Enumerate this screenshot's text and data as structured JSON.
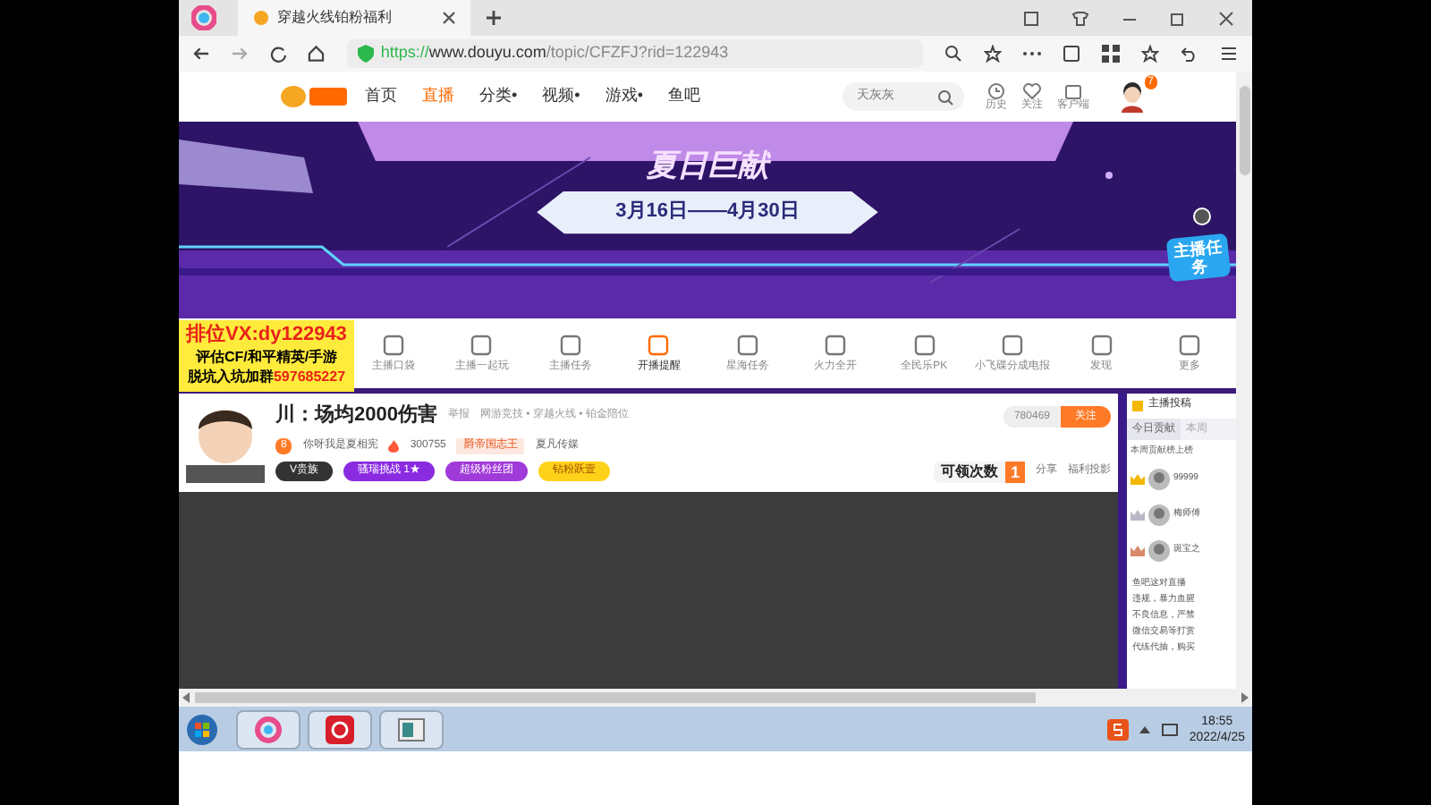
{
  "browser": {
    "tab_title": "穿越火线铂粉福利",
    "url_scheme": "https://",
    "url_host": "www.douyu.com",
    "url_path": "/topic/CFZFJ?rid=122943"
  },
  "site_nav": {
    "items": [
      {
        "label": "首页",
        "selected": false
      },
      {
        "label": "直播",
        "selected": true
      },
      {
        "label": "分类•",
        "selected": false
      },
      {
        "label": "视频•",
        "selected": false
      },
      {
        "label": "游戏•",
        "selected": false
      },
      {
        "label": "鱼吧",
        "selected": false
      }
    ],
    "search_placeholder": "天灰灰",
    "shortcuts": [
      "历史",
      "关注",
      "客户端"
    ],
    "avatar_badge": "7"
  },
  "banner": {
    "subtitle": "夏日巨献",
    "dates": "3月16日——4月30日",
    "task_badge": "主播任务"
  },
  "overlay": {
    "line_1": "排位VX:dy122943",
    "line_2": "评估CF/和平精英/手游",
    "line_3_prefix": "脱坑入坑加群",
    "line_3_number": "597685227"
  },
  "toolbar": [
    {
      "label": "主播口袋",
      "selected": false
    },
    {
      "label": "主播一起玩",
      "selected": false
    },
    {
      "label": "主播任务",
      "selected": false
    },
    {
      "label": "开播提醒",
      "selected": true
    },
    {
      "label": "星海任务",
      "selected": false
    },
    {
      "label": "火力全开",
      "selected": false
    },
    {
      "label": "全民乐PK",
      "selected": false
    },
    {
      "label": "小飞碟分成电报",
      "selected": false
    },
    {
      "label": "发现",
      "selected": false
    },
    {
      "label": "更多",
      "selected": false
    }
  ],
  "stream": {
    "title": "川：场均2000伤害",
    "report": "举报",
    "category": "网游竞技 • 穿越火线 • 铂金陪位",
    "level": "8",
    "owner": "你呀我是夏相宪",
    "heat": "300755",
    "guild": "爵帝国志王",
    "agency": "夏凡传媒",
    "followers": "780469",
    "follow": "关注",
    "tags": [
      "V贵族",
      "骚瑞挑战 1★",
      "超级粉丝团",
      "钻粉跃壹"
    ],
    "claim": "可领次数",
    "claim_count": "1",
    "share": "分享",
    "report_2": "福利投影"
  },
  "ranking": {
    "title": "主播投稿",
    "tabs": [
      {
        "label": "今日贡献",
        "selected": true
      },
      {
        "label": "本周",
        "selected": false
      }
    ],
    "notice": "本周贡献榜上榜",
    "rows": [
      {
        "name": "99999",
        "color": "#f5b800"
      },
      {
        "name": "梅师傅",
        "color": "#b8b8c8"
      },
      {
        "name": "斑宝之",
        "color": "#d98a6a"
      }
    ],
    "chat": [
      "鱼吧这对直播",
      "违规，暴力血腥",
      "不良信息，严禁",
      "微信交易等打赏",
      "代练代抽，购买"
    ]
  },
  "taskbar": {
    "time": "18:55",
    "date": "2022/4/25"
  }
}
